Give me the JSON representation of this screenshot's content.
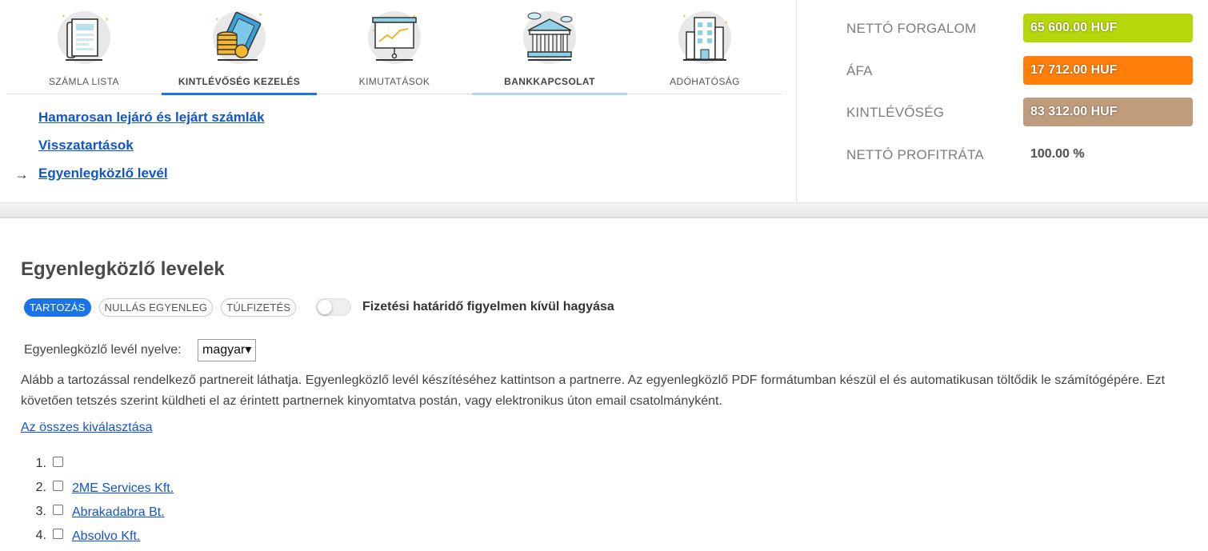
{
  "tabs": [
    {
      "label": "SZÁMLA LISTA",
      "icon": "invoice-list-icon",
      "bold": false,
      "state": "normal"
    },
    {
      "label": "KINTLÉVŐSÉG KEZELÉS",
      "icon": "coins-money-icon",
      "bold": true,
      "state": "active"
    },
    {
      "label": "KIMUTATÁSOK",
      "icon": "presentation-chart-icon",
      "bold": false,
      "state": "normal"
    },
    {
      "label": "BANKKAPCSOLAT",
      "icon": "bank-building-icon",
      "bold": true,
      "state": "hover"
    },
    {
      "label": "ADÓHATÓSÁG",
      "icon": "office-building-icon",
      "bold": false,
      "state": "normal"
    }
  ],
  "sublinks": [
    {
      "label": "Hamarosan lejáró és lejárt számlák",
      "current": false
    },
    {
      "label": "Visszatartások",
      "current": false
    },
    {
      "label": "Egyenlegközlő levél",
      "current": true
    }
  ],
  "stats": [
    {
      "key": "NETTÓ FORGALOM",
      "value": "65 600.00 HUF",
      "color": "#b6d80a"
    },
    {
      "key": "ÁFA",
      "value": "17 712.00 HUF",
      "color": "#ff7f0a"
    },
    {
      "key": "KINTLÉVŐSÉG",
      "value": "83 312.00 HUF",
      "color": "#bf9c7b"
    },
    {
      "key": "NETTÓ PROFITRÁTA",
      "value": "100.00 %",
      "color": ""
    }
  ],
  "main": {
    "title": "Egyenlegközlő levelek",
    "filters": [
      {
        "label": "TARTOZÁS",
        "selected": true
      },
      {
        "label": "NULLÁS EGYENLEG",
        "selected": false
      },
      {
        "label": "TÚLFIZETÉS",
        "selected": false
      }
    ],
    "toggle_on": false,
    "toggle_label": "Fizetési határidő figyelmen kívül hagyása",
    "lang_label": "Egyenlegközlő levél nyelve:",
    "lang_value": "magyar",
    "description": "Alább a tartozással rendelkező partnereit láthatja. Egyenlegközlő levél készítéséhez kattintson a partnerre. Az egyenlegközlő PDF formátumban készül el és automatikusan töltődik le számítógépére. Ezt követően tetszés szerint küldheti el az érintett partnernek kinyomtatva postán, vagy elektronikus úton email csatolmányként.",
    "select_all": "Az összes kiválasztása",
    "partners": [
      {
        "num": "1.",
        "name": ""
      },
      {
        "num": "2.",
        "name": "2ME Services Kft."
      },
      {
        "num": "3.",
        "name": "Abrakadabra Bt."
      },
      {
        "num": "4.",
        "name": "Absolvo Kft."
      }
    ]
  }
}
